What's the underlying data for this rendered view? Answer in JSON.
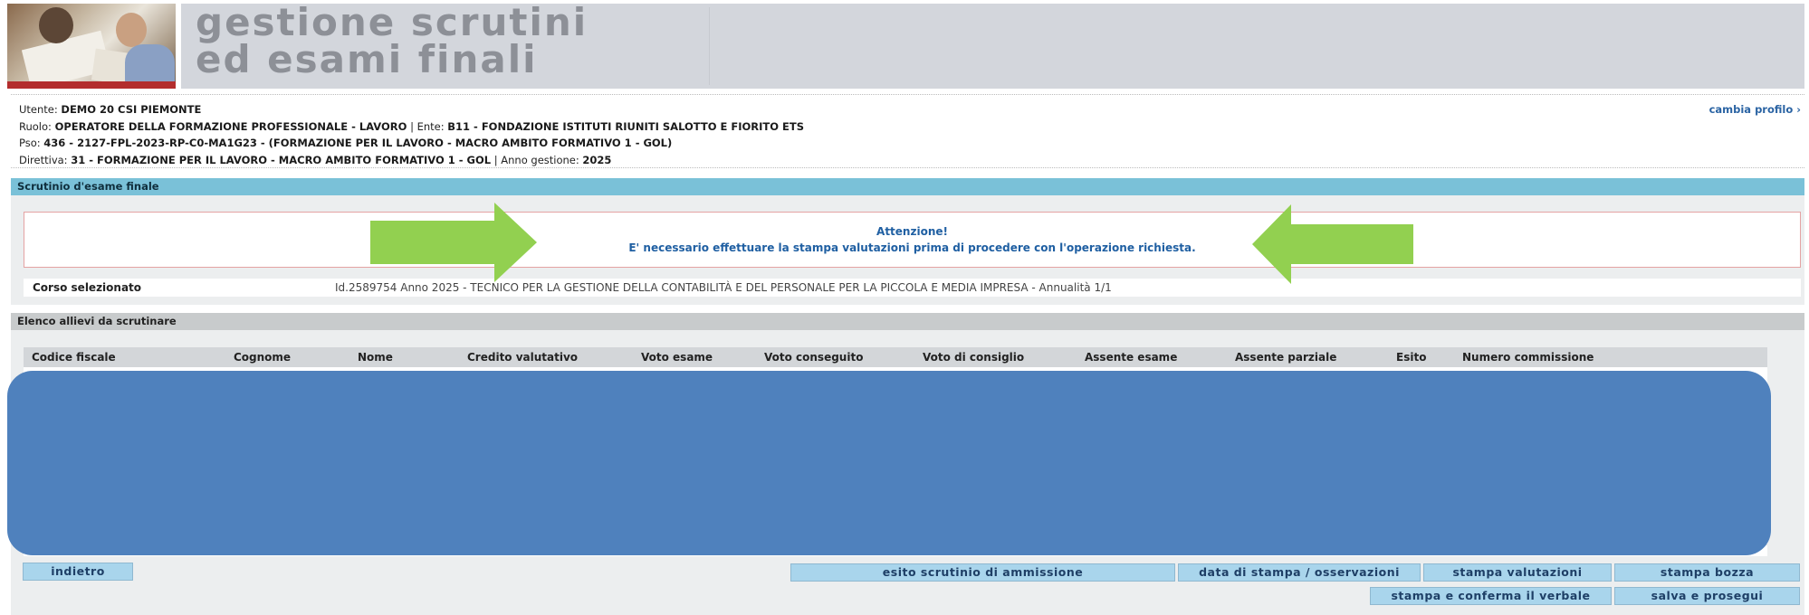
{
  "header": {
    "title_line1": "gestione scrutini",
    "title_line2": "ed esami finali"
  },
  "user_info": {
    "utente_label": "Utente:",
    "utente_value": "DEMO 20 CSI PIEMONTE",
    "ruolo_label": "Ruolo:",
    "ruolo_value": "OPERATORE DELLA FORMAZIONE PROFESSIONALE - LAVORO",
    "ente_label": "| Ente:",
    "ente_value": "B11 - FONDAZIONE ISTITUTI RIUNITI SALOTTO E FIORITO ETS",
    "pso_label": "Pso:",
    "pso_value": "436 - 2127-FPL-2023-RP-C0-MA1G23 - (FORMAZIONE PER IL LAVORO - MACRO AMBITO FORMATIVO 1 - GOL)",
    "direttiva_label": "Direttiva:",
    "direttiva_value": "31 - FORMAZIONE PER IL LAVORO - MACRO AMBITO FORMATIVO 1 - GOL",
    "anno_label": "| Anno gestione:",
    "anno_value": "2025",
    "cambia_profilo": "cambia profilo ›"
  },
  "scrutinio": {
    "section_title": "Scrutinio d'esame finale",
    "alert_title": "Attenzione!",
    "alert_message": "E' necessario effettuare la stampa valutazioni prima di procedere con l'operazione richiesta.",
    "course_label": "Corso selezionato",
    "course_value": "Id.2589754 Anno 2025 - TECNICO PER LA GESTIONE DELLA CONTABILITÀ E DEL PERSONALE PER LA PICCOLA E MEDIA IMPRESA - Annualità 1/1"
  },
  "elenco": {
    "section_title": "Elenco allievi da scrutinare",
    "columns": [
      "Codice fiscale",
      "Cognome",
      "Nome",
      "Credito valutativo",
      "Voto esame",
      "Voto conseguito",
      "Voto di consiglio",
      "Assente esame",
      "Assente parziale",
      "Esito",
      "Numero commissione"
    ]
  },
  "buttons": {
    "indietro": "indietro",
    "esito_ammissione": "esito scrutinio di ammissione",
    "data_stampa": "data di stampa / osservazioni",
    "stampa_valutazioni": "stampa valutazioni",
    "stampa_bozza": "stampa bozza",
    "stampa_conferma": "stampa e conferma il verbale",
    "salva_prosegui": "salva e prosegui"
  },
  "colors": {
    "section_bar": "#7ac1d8",
    "alert_text": "#1f5fa2",
    "arrow": "#92d050",
    "redaction": "#4f81bd",
    "button": "#a9d5ec"
  }
}
